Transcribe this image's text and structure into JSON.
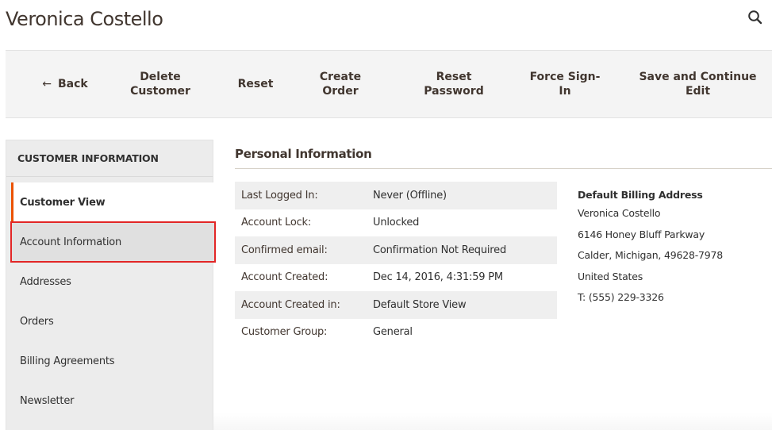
{
  "header": {
    "title": "Veronica Costello",
    "search_icon": "search-icon"
  },
  "toolbar": {
    "back_icon": "arrow-left-icon",
    "back_arrow": "←",
    "back_label": "Back",
    "delete_line1": "Delete",
    "delete_line2": "Customer",
    "reset_label": "Reset",
    "create_order_line1": "Create",
    "create_order_line2": "Order",
    "reset_password_line1": "Reset",
    "reset_password_line2": "Password",
    "force_signin_line1": "Force Sign-",
    "force_signin_line2": "In",
    "save_continue_line1": "Save and Continue",
    "save_continue_line2": "Edit"
  },
  "sidebar": {
    "title": "CUSTOMER INFORMATION",
    "items": [
      {
        "label": "Customer View",
        "state": "active"
      },
      {
        "label": "Account Information",
        "state": "highlighted"
      },
      {
        "label": "Addresses",
        "state": ""
      },
      {
        "label": "Orders",
        "state": ""
      },
      {
        "label": "Billing Agreements",
        "state": ""
      },
      {
        "label": "Newsletter",
        "state": ""
      }
    ]
  },
  "personal_info": {
    "title": "Personal Information",
    "rows": [
      {
        "label": "Last Logged In:",
        "value": "Never (Offline)"
      },
      {
        "label": "Account Lock:",
        "value": "Unlocked"
      },
      {
        "label": "Confirmed email:",
        "value": "Confirmation Not Required"
      },
      {
        "label": "Account Created:",
        "value": "Dec 14, 2016, 4:31:59 PM"
      },
      {
        "label": "Account Created in:",
        "value": "Default Store View"
      },
      {
        "label": "Customer Group:",
        "value": "General"
      }
    ]
  },
  "billing_address": {
    "title": "Default Billing Address",
    "name": "Veronica Costello",
    "street": "6146 Honey Bluff Parkway",
    "city_line": "Calder, Michigan, 49628-7978",
    "country": "United States",
    "phone": "T: (555) 229-3326"
  },
  "colors": {
    "accent_active": "#eb5202",
    "highlight_outline": "#e22626",
    "toolbar_bg": "#f4f4f4",
    "sidebar_bg": "#ececec"
  }
}
